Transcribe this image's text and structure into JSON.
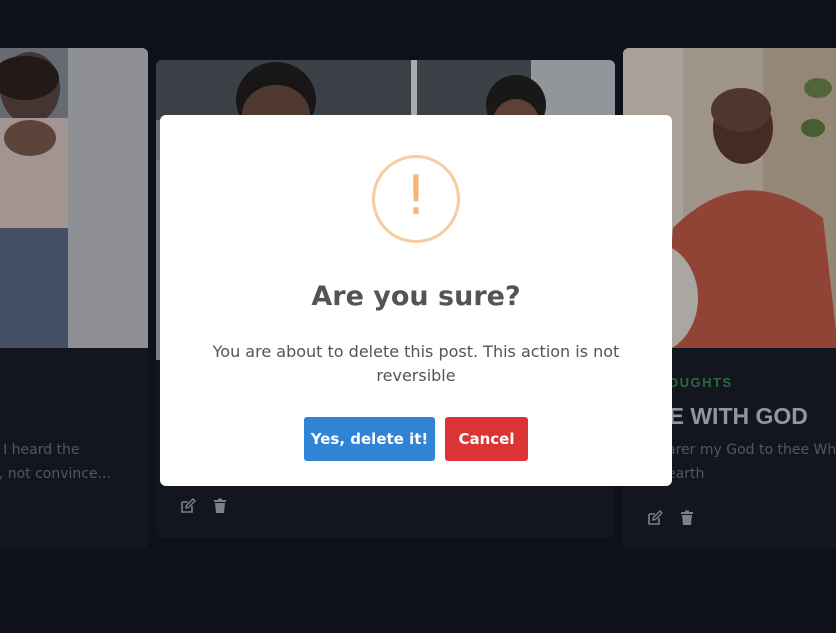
{
  "cards": [
    {
      "excerpt_lines": [
        "e I heard the",
        "lf, not convince..."
      ]
    },
    {
      "excerpt_lines": []
    },
    {
      "category": "OUGHTS",
      "title": "NE WITH GOD",
      "excerpt_lines": [
        "arer my God to thee Wh",
        "earth"
      ]
    }
  ],
  "dialog": {
    "icon": "!",
    "title": "Are you sure?",
    "message": "You are about to delete this post. This action is not reversible",
    "confirm_label": "Yes, delete it!",
    "cancel_label": "Cancel"
  },
  "colors": {
    "background": "#10141d",
    "card": "#171b24",
    "category": "#3c8a55",
    "confirm_button": "#2f84d6",
    "cancel_button": "#dc3434",
    "warning_icon": "#f6b678"
  }
}
